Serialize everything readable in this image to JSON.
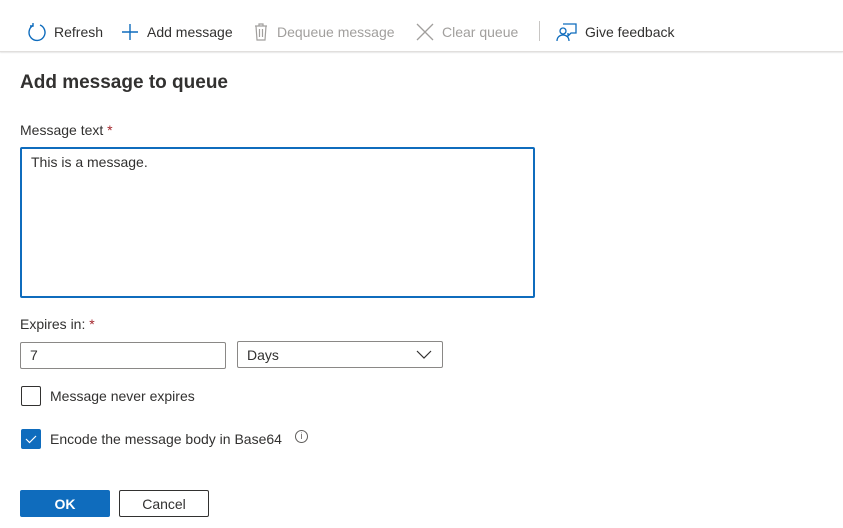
{
  "toolbar": {
    "refresh": "Refresh",
    "add": "Add message",
    "dequeue": "Dequeue message",
    "clear": "Clear queue",
    "feedback": "Give feedback"
  },
  "form": {
    "title": "Add message to queue",
    "message_label": "Message text",
    "message_value": "This is a message.",
    "required_mark": "*",
    "expires_label": "Expires in:",
    "expires_value": "7",
    "unit_value": "Days",
    "never_expires_label": "Message never expires",
    "never_expires_checked": false,
    "base64_label": "Encode the message body in Base64",
    "base64_checked": true,
    "info_glyph": "i",
    "ok": "OK",
    "cancel": "Cancel"
  },
  "colors": {
    "accent": "#0f6cbd",
    "required": "#a4262c",
    "disabled": "#a19f9d"
  }
}
